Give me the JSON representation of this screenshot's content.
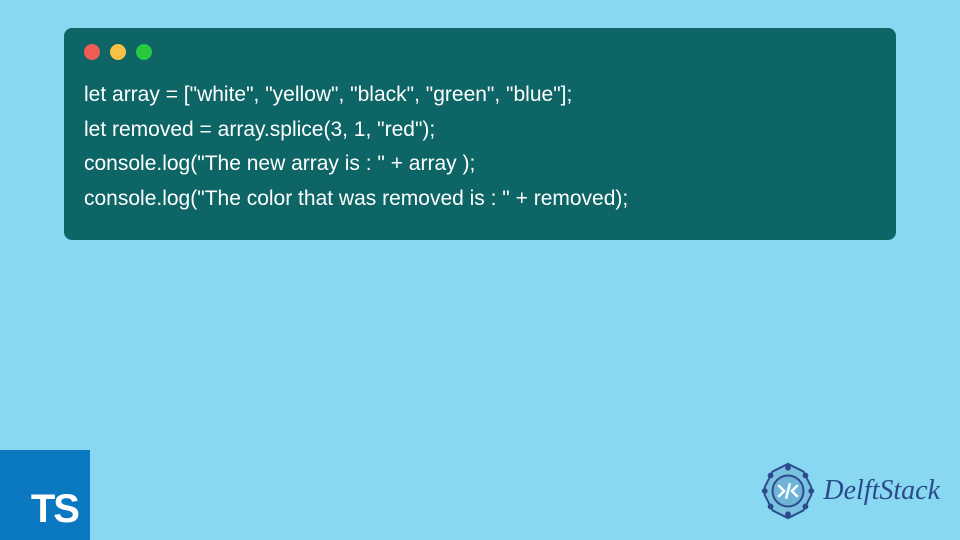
{
  "code": {
    "line1": "let array = [\"white\", \"yellow\", \"black\", \"green\", \"blue\"];",
    "line2": "let removed = array.splice(3, 1, \"red\");",
    "line3": "console.log(\"The new array is : \" + array );",
    "line4": "console.log(\"The color that was removed is : \" + removed);"
  },
  "badge": {
    "ts": "TS"
  },
  "brand": {
    "name": "DelftStack"
  },
  "colors": {
    "background": "#87d8f0",
    "codeWindow": "#0d6565",
    "tsBadge": "#0b78c2",
    "brandText": "#2c4a8c"
  }
}
